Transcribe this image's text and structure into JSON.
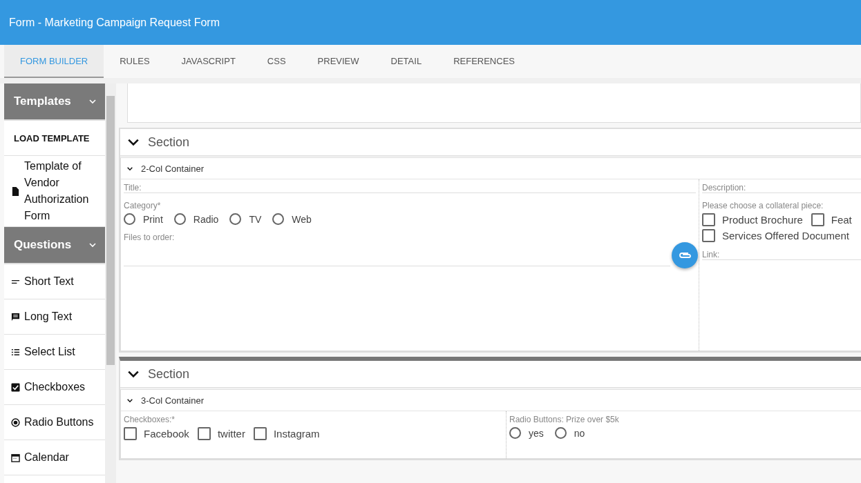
{
  "window": {
    "title": "Form - Marketing Campaign Request Form"
  },
  "tabs": [
    {
      "label": "FORM BUILDER",
      "selected": true
    },
    {
      "label": "RULES",
      "selected": false
    },
    {
      "label": "JAVASCRIPT",
      "selected": false
    },
    {
      "label": "CSS",
      "selected": false
    },
    {
      "label": "PREVIEW",
      "selected": false
    },
    {
      "label": "DETAIL",
      "selected": false
    },
    {
      "label": "REFERENCES",
      "selected": false
    }
  ],
  "sidebar": {
    "groups": [
      {
        "title": "Templates",
        "expanded": true,
        "items": [
          {
            "kind": "action",
            "label": "LOAD TEMPLATE"
          },
          {
            "kind": "document",
            "label": "Template of Vendor Authorization Form"
          }
        ]
      },
      {
        "title": "Questions",
        "expanded": true,
        "items": [
          {
            "kind": "short-text",
            "label": "Short Text"
          },
          {
            "kind": "long-text",
            "label": "Long Text"
          },
          {
            "kind": "select-list",
            "label": "Select List"
          },
          {
            "kind": "checkboxes",
            "label": "Checkboxes"
          },
          {
            "kind": "radio-buttons",
            "label": "Radio Buttons"
          },
          {
            "kind": "calendar",
            "label": "Calendar"
          }
        ]
      }
    ]
  },
  "sections": [
    {
      "title": "Section",
      "expanded": true,
      "container": {
        "title": "2-Col Container",
        "expanded": true,
        "columns": [
          {
            "fields": [
              {
                "kind": "text",
                "label": "Title:"
              },
              {
                "kind": "radio",
                "label": "Category*",
                "options": [
                  {
                    "label": "Print",
                    "selected": false
                  },
                  {
                    "label": "Radio",
                    "selected": false
                  },
                  {
                    "label": "TV",
                    "selected": false
                  },
                  {
                    "label": "Web",
                    "selected": false
                  }
                ]
              },
              {
                "kind": "file",
                "label": "Files to order:"
              }
            ]
          },
          {
            "fields": [
              {
                "kind": "text",
                "label": "Description:"
              },
              {
                "kind": "checkbox",
                "label": "Please choose a collateral piece:",
                "options": [
                  {
                    "label": "Product Brochure",
                    "checked": false
                  },
                  {
                    "label": "Feat",
                    "checked": false
                  },
                  {
                    "label": "Services Offered Document",
                    "checked": false
                  }
                ]
              },
              {
                "kind": "text",
                "label": "Link:"
              }
            ]
          }
        ]
      }
    },
    {
      "title": "Section",
      "expanded": true,
      "container": {
        "title": "3-Col Container",
        "expanded": true,
        "columns": [
          {
            "fields": [
              {
                "kind": "checkbox",
                "label": "Checkboxes:*",
                "options": [
                  {
                    "label": "Facebook",
                    "checked": false
                  },
                  {
                    "label": "twitter",
                    "checked": false
                  },
                  {
                    "label": "Instagram",
                    "checked": false
                  }
                ]
              }
            ]
          },
          {
            "fields": [
              {
                "kind": "radio",
                "label": "Radio Buttons: Prize over $5k",
                "options": [
                  {
                    "label": "yes",
                    "selected": false
                  },
                  {
                    "label": "no",
                    "selected": false
                  }
                ]
              }
            ]
          }
        ]
      }
    }
  ]
}
